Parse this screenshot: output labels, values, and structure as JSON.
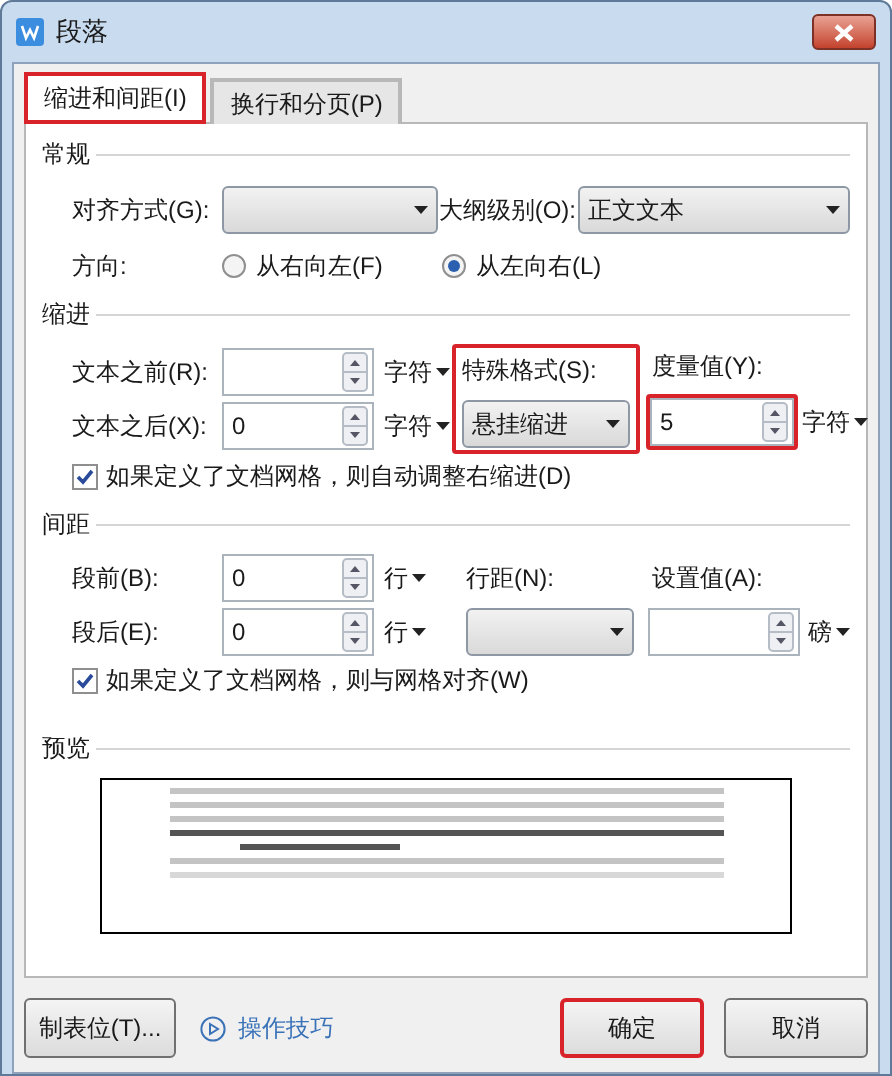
{
  "window": {
    "title": "段落"
  },
  "tabs": [
    {
      "label": "缩进和间距(I)",
      "selected": true,
      "highlighted": true
    },
    {
      "label": "换行和分页(P)",
      "selected": false,
      "highlighted": false
    }
  ],
  "general": {
    "heading": "常规",
    "alignment": {
      "label": "对齐方式(G):"
    },
    "outline_level": {
      "label": "大纲级别(O):",
      "value": "正文文本"
    },
    "direction": {
      "label": "方向:",
      "options": [
        {
          "label": "从右向左(F)",
          "selected": false
        },
        {
          "label": "从左向右(L)",
          "selected": true
        }
      ]
    }
  },
  "indent": {
    "heading": "缩进",
    "before": {
      "label": "文本之前(R):",
      "unit": "字符"
    },
    "after": {
      "label": "文本之后(X):",
      "value": "0",
      "unit": "字符"
    },
    "special": {
      "label": "特殊格式(S):",
      "value": "悬挂缩进",
      "highlighted": true
    },
    "measure": {
      "label": "度量值(Y):",
      "value": "5",
      "unit": "字符",
      "highlighted": true
    },
    "grid_check": {
      "label": "如果定义了文档网格，则自动调整右缩进(D)",
      "checked": true
    }
  },
  "spacing": {
    "heading": "间距",
    "before": {
      "label": "段前(B):",
      "value": "0",
      "unit": "行"
    },
    "after": {
      "label": "段后(E):",
      "value": "0",
      "unit": "行"
    },
    "line_spacing": {
      "label": "行距(N):"
    },
    "set_value": {
      "label": "设置值(A):",
      "unit": "磅"
    },
    "grid_check": {
      "label": "如果定义了文档网格，则与网格对齐(W)",
      "checked": true
    }
  },
  "preview": {
    "heading": "预览"
  },
  "buttons": [
    {
      "label": "制表位(T)...",
      "kind": "button",
      "highlighted": false
    },
    {
      "label": "操作技巧",
      "kind": "link",
      "highlighted": false
    },
    {
      "label": "确定",
      "kind": "button",
      "highlighted": true
    },
    {
      "label": "取消",
      "kind": "button",
      "highlighted": false
    }
  ]
}
